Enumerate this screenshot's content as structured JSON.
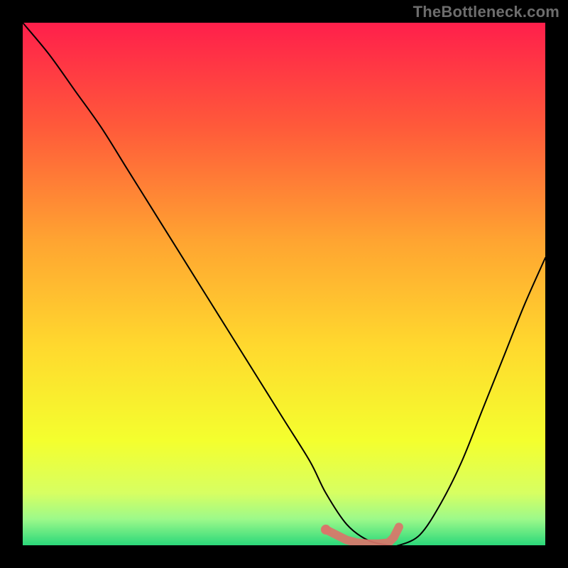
{
  "watermark": "TheBottleneck.com",
  "chart_data": {
    "type": "line",
    "title": "",
    "xlabel": "",
    "ylabel": "",
    "xlim": [
      0,
      100
    ],
    "ylim": [
      0,
      100
    ],
    "grid": false,
    "legend": false,
    "background_gradient": {
      "stops": [
        {
          "offset": 0.0,
          "color": "#ff1f4b"
        },
        {
          "offset": 0.2,
          "color": "#ff5a3a"
        },
        {
          "offset": 0.42,
          "color": "#ffa531"
        },
        {
          "offset": 0.62,
          "color": "#ffd92e"
        },
        {
          "offset": 0.8,
          "color": "#f4ff2e"
        },
        {
          "offset": 0.9,
          "color": "#d7ff62"
        },
        {
          "offset": 0.95,
          "color": "#9cf98a"
        },
        {
          "offset": 1.0,
          "color": "#2bd87a"
        }
      ]
    },
    "series": [
      {
        "name": "bottleneck-curve",
        "color": "#000000",
        "x": [
          0,
          5,
          10,
          15,
          20,
          25,
          30,
          35,
          40,
          45,
          50,
          55,
          58,
          62,
          66,
          70,
          72,
          76,
          80,
          84,
          88,
          92,
          96,
          100
        ],
        "y": [
          100,
          94,
          87,
          80,
          72,
          64,
          56,
          48,
          40,
          32,
          24,
          16,
          10,
          4,
          1,
          0,
          0,
          2,
          8,
          16,
          26,
          36,
          46,
          55
        ]
      },
      {
        "name": "optimal-range-marker",
        "type": "scatter",
        "color": "#d9756a",
        "x": [
          58,
          60,
          62,
          64,
          66,
          68,
          70,
          71,
          72
        ],
        "y": [
          3,
          2,
          1,
          0.5,
          0.3,
          0.3,
          0.5,
          1.5,
          3.5
        ]
      }
    ]
  }
}
